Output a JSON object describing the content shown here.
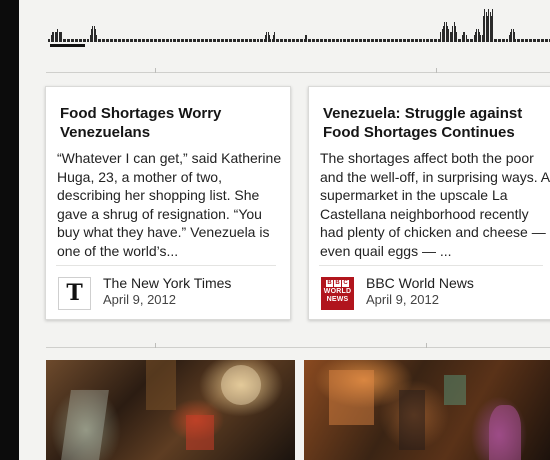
{
  "timeline": {
    "bars": [
      1,
      1,
      2,
      3,
      3,
      3,
      3,
      4,
      3,
      3,
      3,
      1,
      1,
      1,
      1,
      1,
      1,
      1,
      1,
      1,
      1,
      1,
      1,
      1,
      1,
      1,
      1,
      1,
      1,
      1,
      1,
      2,
      4,
      5,
      5,
      4,
      2,
      1,
      1,
      1,
      1,
      1,
      1,
      1,
      1,
      1,
      1,
      1,
      1,
      1,
      1,
      1,
      1,
      1,
      1,
      1,
      1,
      1,
      1,
      1,
      1,
      1,
      1,
      1,
      1,
      1,
      1,
      1,
      1,
      1,
      1,
      1,
      1,
      1,
      1,
      1,
      1,
      1,
      1,
      1,
      1,
      1,
      1,
      1,
      1,
      1,
      1,
      1,
      1,
      1,
      1,
      1,
      1,
      1,
      1,
      1,
      1,
      1,
      1,
      1,
      1,
      1,
      1,
      1,
      1,
      1,
      1,
      1,
      1,
      1,
      1,
      1,
      1,
      1,
      1,
      1,
      1,
      1,
      1,
      1,
      1,
      1,
      1,
      1,
      1,
      1,
      1,
      1,
      1,
      1,
      1,
      1,
      1,
      1,
      1,
      1,
      1,
      1,
      1,
      1,
      1,
      1,
      1,
      1,
      1,
      1,
      1,
      1,
      1,
      1,
      1,
      1,
      1,
      1,
      1,
      1,
      1,
      1,
      1,
      1,
      1,
      1,
      2,
      3,
      3,
      2,
      1,
      1,
      2,
      3,
      1,
      1,
      1,
      1,
      1,
      1,
      1,
      1,
      1,
      1,
      1,
      1,
      1,
      1,
      1,
      1,
      1,
      1,
      1,
      1,
      1,
      1,
      2,
      2,
      1,
      1,
      1,
      1,
      1,
      1,
      1,
      1,
      1,
      1,
      1,
      1,
      1,
      1,
      1,
      1,
      1,
      1,
      1,
      1,
      1,
      1,
      1,
      1,
      1,
      1,
      1,
      1,
      1,
      1,
      1,
      1,
      1,
      1,
      1,
      1,
      1,
      1,
      1,
      1,
      1,
      1,
      1,
      1,
      1,
      1,
      1,
      1,
      1,
      1,
      1,
      1,
      1,
      1,
      1,
      1,
      1,
      1,
      1,
      1,
      1,
      1,
      1,
      1,
      1,
      1,
      1,
      1,
      1,
      1,
      1,
      1,
      1,
      1,
      1,
      1,
      1,
      1,
      1,
      1,
      1,
      1,
      1,
      1,
      1,
      1,
      1,
      1,
      1,
      1,
      1,
      1,
      1,
      1,
      1,
      1,
      1,
      1,
      1,
      3,
      4,
      5,
      6,
      6,
      5,
      4,
      3,
      3,
      5,
      6,
      5,
      3,
      1,
      1,
      1,
      2,
      3,
      3,
      2,
      1,
      1,
      1,
      1,
      1,
      2,
      3,
      4,
      4,
      3,
      2,
      2,
      8,
      10,
      9,
      8,
      10,
      9,
      8,
      10,
      1,
      1,
      1,
      1,
      1,
      1,
      1,
      1,
      1,
      1,
      1,
      2,
      3,
      4,
      4,
      3,
      1,
      1,
      1,
      1,
      1,
      1,
      1,
      1,
      1,
      1,
      1,
      1,
      1,
      1,
      1,
      1,
      1,
      1,
      1,
      1,
      1,
      1,
      1,
      1,
      1,
      1
    ]
  },
  "articles": [
    {
      "title": "Food Shortages Worry Venezuelans",
      "summary": "“Whatever I can get,” said Katherine Huga, 23, a mother of two, describing her shopping list. She gave a shrug of resignation. “You buy what they have.” Venezuela is one of the world’s...",
      "source": "The New York Times",
      "date": "April 9, 2012",
      "logo": "nyt-logo",
      "logo_text": "T"
    },
    {
      "title": "Venezuela: Struggle against Food Shortages Continues",
      "summary": "The shortages affect both the poor and the well-off, in surprising ways. A supermarket in the upscale La Castellana neighborhood recently had plenty of chicken and cheese — even quail eggs — ...",
      "source": "BBC World News",
      "date": "April 9, 2012",
      "logo": "bbc-logo",
      "logo_text": {
        "letters": [
          "B",
          "B",
          "C"
        ],
        "line1": "WORLD",
        "line2": "NEWS"
      }
    }
  ],
  "photos": [
    {
      "name": "market-photo-1"
    },
    {
      "name": "market-photo-2"
    }
  ]
}
